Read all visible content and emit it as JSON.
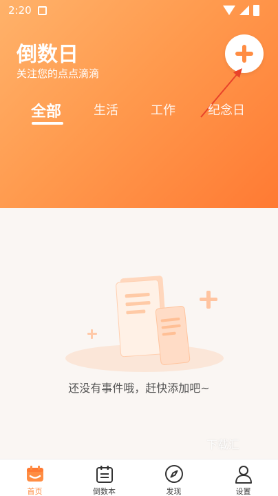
{
  "status_bar": {
    "time": "2:20"
  },
  "header": {
    "title": "倒数日",
    "subtitle": "关注您的点点滴滴"
  },
  "tabs": [
    {
      "label": "全部",
      "active": true
    },
    {
      "label": "生活",
      "active": false
    },
    {
      "label": "工作",
      "active": false
    },
    {
      "label": "纪念日",
      "active": false
    }
  ],
  "empty_state": {
    "message": "还没有事件哦，赶快添加吧~"
  },
  "watermark": "下载汇",
  "bottom_nav": [
    {
      "label": "首页",
      "icon": "home-calendar-icon",
      "active": true
    },
    {
      "label": "倒数本",
      "icon": "notebook-icon",
      "active": false
    },
    {
      "label": "发现",
      "icon": "compass-icon",
      "active": false
    },
    {
      "label": "设置",
      "icon": "user-icon",
      "active": false
    }
  ],
  "colors": {
    "accent": "#ff8d43",
    "header_gradient_start": "#ffb26a",
    "header_gradient_end": "#ff7a33",
    "background": "#faf6f3"
  }
}
